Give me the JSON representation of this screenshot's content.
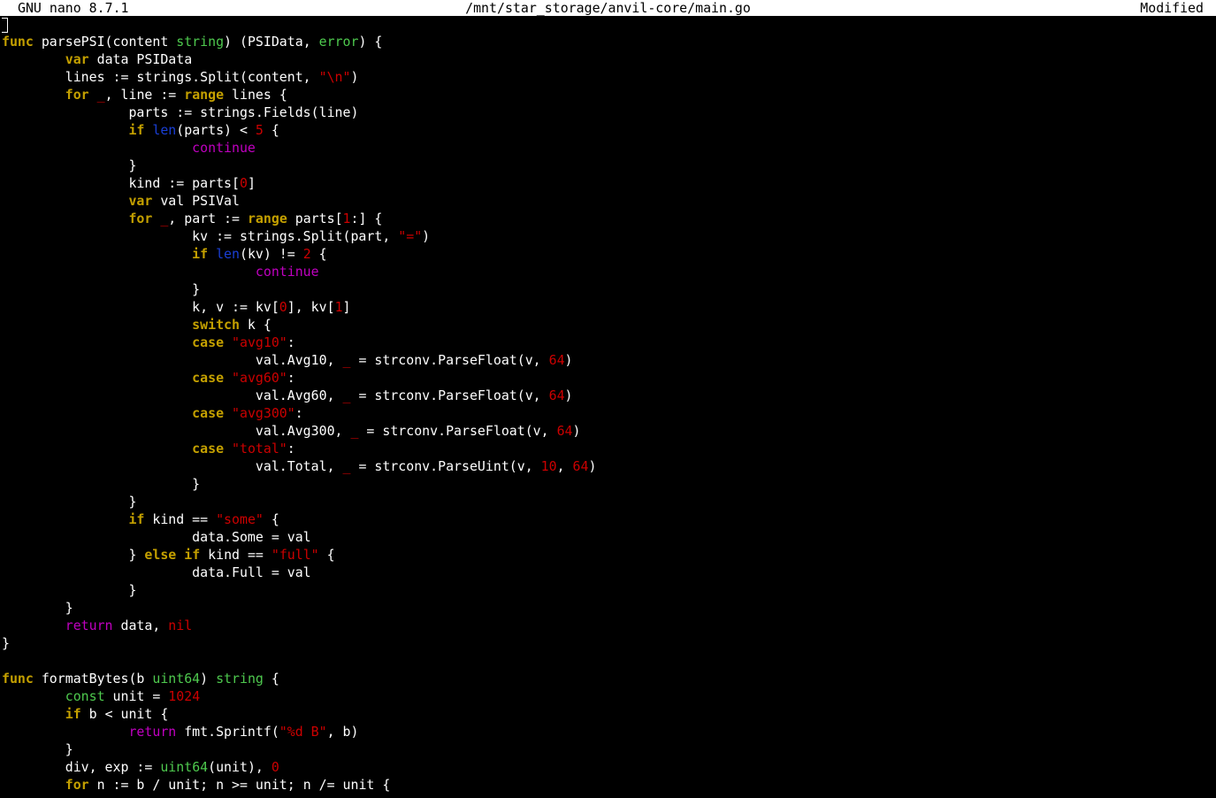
{
  "titlebar": {
    "app": "GNU nano 8.7.1",
    "file": "/mnt/star_storage/anvil-core/main.go",
    "status": "Modified"
  },
  "editor": {
    "lines": [
      [],
      [
        [
          "kw",
          "func"
        ],
        [
          "p",
          " parsePSI(content "
        ],
        [
          "ty",
          "string"
        ],
        [
          "p",
          ") (PSIData, "
        ],
        [
          "ty",
          "error"
        ],
        [
          "p",
          ") {"
        ]
      ],
      [
        [
          "p",
          "\t"
        ],
        [
          "kw",
          "var"
        ],
        [
          "p",
          " data PSIData"
        ]
      ],
      [
        [
          "p",
          "\tlines := strings.Split(content, "
        ],
        [
          "str",
          "\"\\n\""
        ],
        [
          "p",
          ")"
        ]
      ],
      [
        [
          "p",
          "\t"
        ],
        [
          "kw",
          "for"
        ],
        [
          "p",
          " "
        ],
        [
          "blank",
          "_"
        ],
        [
          "p",
          ", line := "
        ],
        [
          "kw",
          "range"
        ],
        [
          "p",
          " lines {"
        ]
      ],
      [
        [
          "p",
          "\t\tparts := strings.Fields(line)"
        ]
      ],
      [
        [
          "p",
          "\t\t"
        ],
        [
          "kw",
          "if"
        ],
        [
          "p",
          " "
        ],
        [
          "bi",
          "len"
        ],
        [
          "p",
          "(parts) < "
        ],
        [
          "num",
          "5"
        ],
        [
          "p",
          " {"
        ]
      ],
      [
        [
          "p",
          "\t\t\t"
        ],
        [
          "fl",
          "continue"
        ]
      ],
      [
        [
          "p",
          "\t\t}"
        ]
      ],
      [
        [
          "p",
          "\t\tkind := parts["
        ],
        [
          "num",
          "0"
        ],
        [
          "p",
          "]"
        ]
      ],
      [
        [
          "p",
          "\t\t"
        ],
        [
          "kw",
          "var"
        ],
        [
          "p",
          " val PSIVal"
        ]
      ],
      [
        [
          "p",
          "\t\t"
        ],
        [
          "kw",
          "for"
        ],
        [
          "p",
          " "
        ],
        [
          "blank",
          "_"
        ],
        [
          "p",
          ", part := "
        ],
        [
          "kw",
          "range"
        ],
        [
          "p",
          " parts["
        ],
        [
          "num",
          "1"
        ],
        [
          "p",
          ":] {"
        ]
      ],
      [
        [
          "p",
          "\t\t\tkv := strings.Split(part, "
        ],
        [
          "str",
          "\"=\""
        ],
        [
          "p",
          ")"
        ]
      ],
      [
        [
          "p",
          "\t\t\t"
        ],
        [
          "kw",
          "if"
        ],
        [
          "p",
          " "
        ],
        [
          "bi",
          "len"
        ],
        [
          "p",
          "(kv) != "
        ],
        [
          "num",
          "2"
        ],
        [
          "p",
          " {"
        ]
      ],
      [
        [
          "p",
          "\t\t\t\t"
        ],
        [
          "fl",
          "continue"
        ]
      ],
      [
        [
          "p",
          "\t\t\t}"
        ]
      ],
      [
        [
          "p",
          "\t\t\tk, v := kv["
        ],
        [
          "num",
          "0"
        ],
        [
          "p",
          "], kv["
        ],
        [
          "num",
          "1"
        ],
        [
          "p",
          "]"
        ]
      ],
      [
        [
          "p",
          "\t\t\t"
        ],
        [
          "kw",
          "switch"
        ],
        [
          "p",
          " k {"
        ]
      ],
      [
        [
          "p",
          "\t\t\t"
        ],
        [
          "kw",
          "case"
        ],
        [
          "p",
          " "
        ],
        [
          "str",
          "\"avg10\""
        ],
        [
          "p",
          ":"
        ]
      ],
      [
        [
          "p",
          "\t\t\t\tval.Avg10, "
        ],
        [
          "blank",
          "_"
        ],
        [
          "p",
          " = strconv.ParseFloat(v, "
        ],
        [
          "num",
          "64"
        ],
        [
          "p",
          ")"
        ]
      ],
      [
        [
          "p",
          "\t\t\t"
        ],
        [
          "kw",
          "case"
        ],
        [
          "p",
          " "
        ],
        [
          "str",
          "\"avg60\""
        ],
        [
          "p",
          ":"
        ]
      ],
      [
        [
          "p",
          "\t\t\t\tval.Avg60, "
        ],
        [
          "blank",
          "_"
        ],
        [
          "p",
          " = strconv.ParseFloat(v, "
        ],
        [
          "num",
          "64"
        ],
        [
          "p",
          ")"
        ]
      ],
      [
        [
          "p",
          "\t\t\t"
        ],
        [
          "kw",
          "case"
        ],
        [
          "p",
          " "
        ],
        [
          "str",
          "\"avg300\""
        ],
        [
          "p",
          ":"
        ]
      ],
      [
        [
          "p",
          "\t\t\t\tval.Avg300, "
        ],
        [
          "blank",
          "_"
        ],
        [
          "p",
          " = strconv.ParseFloat(v, "
        ],
        [
          "num",
          "64"
        ],
        [
          "p",
          ")"
        ]
      ],
      [
        [
          "p",
          "\t\t\t"
        ],
        [
          "kw",
          "case"
        ],
        [
          "p",
          " "
        ],
        [
          "str",
          "\"total\""
        ],
        [
          "p",
          ":"
        ]
      ],
      [
        [
          "p",
          "\t\t\t\tval.Total, "
        ],
        [
          "blank",
          "_"
        ],
        [
          "p",
          " = strconv.ParseUint(v, "
        ],
        [
          "num",
          "10"
        ],
        [
          "p",
          ", "
        ],
        [
          "num",
          "64"
        ],
        [
          "p",
          ")"
        ]
      ],
      [
        [
          "p",
          "\t\t\t}"
        ]
      ],
      [
        [
          "p",
          "\t\t}"
        ]
      ],
      [
        [
          "p",
          "\t\t"
        ],
        [
          "kw",
          "if"
        ],
        [
          "p",
          " kind == "
        ],
        [
          "str",
          "\"some\""
        ],
        [
          "p",
          " {"
        ]
      ],
      [
        [
          "p",
          "\t\t\tdata.Some = val"
        ]
      ],
      [
        [
          "p",
          "\t\t} "
        ],
        [
          "kw",
          "else"
        ],
        [
          "p",
          " "
        ],
        [
          "kw",
          "if"
        ],
        [
          "p",
          " kind == "
        ],
        [
          "str",
          "\"full\""
        ],
        [
          "p",
          " {"
        ]
      ],
      [
        [
          "p",
          "\t\t\tdata.Full = val"
        ]
      ],
      [
        [
          "p",
          "\t\t}"
        ]
      ],
      [
        [
          "p",
          "\t}"
        ]
      ],
      [
        [
          "p",
          "\t"
        ],
        [
          "fl",
          "return"
        ],
        [
          "p",
          " data, "
        ],
        [
          "num",
          "nil"
        ]
      ],
      [
        [
          "p",
          "}"
        ]
      ],
      [],
      [
        [
          "kw",
          "func"
        ],
        [
          "p",
          " formatBytes(b "
        ],
        [
          "ty",
          "uint64"
        ],
        [
          "p",
          ") "
        ],
        [
          "ty",
          "string"
        ],
        [
          "p",
          " {"
        ]
      ],
      [
        [
          "p",
          "\t"
        ],
        [
          "ty",
          "const"
        ],
        [
          "p",
          " unit = "
        ],
        [
          "num",
          "1024"
        ]
      ],
      [
        [
          "p",
          "\t"
        ],
        [
          "kw",
          "if"
        ],
        [
          "p",
          " b < unit {"
        ]
      ],
      [
        [
          "p",
          "\t\t"
        ],
        [
          "fl",
          "return"
        ],
        [
          "p",
          " fmt.Sprintf("
        ],
        [
          "str",
          "\"%d B\""
        ],
        [
          "p",
          ", b)"
        ]
      ],
      [
        [
          "p",
          "\t}"
        ]
      ],
      [
        [
          "p",
          "\tdiv, exp := "
        ],
        [
          "ty",
          "uint64"
        ],
        [
          "p",
          "(unit), "
        ],
        [
          "num",
          "0"
        ]
      ],
      [
        [
          "p",
          "\t"
        ],
        [
          "kw",
          "for"
        ],
        [
          "p",
          " n := b / unit; n >= unit; n /= unit {"
        ]
      ]
    ]
  }
}
